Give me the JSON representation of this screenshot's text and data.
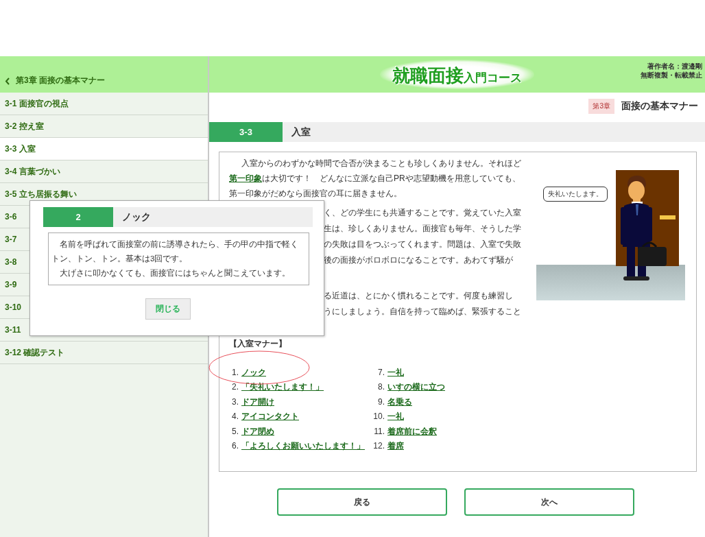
{
  "sidebar": {
    "chapter_title": "第3章 面接の基本マナー",
    "items": [
      {
        "label": "3-1 面接官の視点",
        "selected": false
      },
      {
        "label": "3-2 控え室",
        "selected": false
      },
      {
        "label": "3-3 入室",
        "selected": true
      },
      {
        "label": "3-4 言葉づかい",
        "selected": false
      },
      {
        "label": "3-5 立ち居振る舞い",
        "selected": false
      },
      {
        "label": "3-6",
        "selected": false
      },
      {
        "label": "3-7",
        "selected": false
      },
      {
        "label": "3-8",
        "selected": false
      },
      {
        "label": "3-9",
        "selected": false
      },
      {
        "label": "3-10",
        "selected": false
      },
      {
        "label": "3-11",
        "selected": false
      },
      {
        "label": "3-12 確認テスト",
        "selected": false
      }
    ]
  },
  "header": {
    "logo_main": "就職面接",
    "logo_sub": "入門コース",
    "credits": [
      "著作者名：渡邉剛",
      "無断複製・転載禁止"
    ]
  },
  "chapter": {
    "badge": "第3章",
    "title": "面接の基本マナー"
  },
  "section": {
    "number": "3-3",
    "title": "入室"
  },
  "content": {
    "intro": {
      "before": "入室からのわずかな時間で合否が決まることも珍しくありません。それほど",
      "link": "第一印象",
      "after": "は大切です！　どんなに立派な自己PRや志望動機を用意していても、第一印象がだめなら面接官の耳に届きません。"
    },
    "partial_paragraphs": [
      [
        "く、どの学生にも共通することです。覚えていた入室",
        "生は、珍しくありません。面接官も毎年、そうした学",
        "の失敗は目をつぶってくれます。問題は、入室で失敗",
        "後の面接がボロボロになることです。あわてず騒が"
      ],
      [
        "る近道は、とにかく慣れることです。何度も練習し",
        "うにしましょう。自信を持って臨めば、緊張すること"
      ]
    ],
    "speech": "失礼いたします。",
    "list_title": "【入室マナー】",
    "steps": [
      {
        "number": "1.",
        "label": "ノック"
      },
      {
        "number": "2.",
        "label": "「失礼いたします！」"
      },
      {
        "number": "3.",
        "label": "ドア開け"
      },
      {
        "number": "4.",
        "label": "アイコンタクト"
      },
      {
        "number": "5.",
        "label": "ドア閉め"
      },
      {
        "number": "6.",
        "label": "「よろしくお願いいたします！」"
      },
      {
        "number": "7.",
        "label": "一礼"
      },
      {
        "number": "8.",
        "label": "いすの横に立つ"
      },
      {
        "number": "9.",
        "label": "名乗る"
      },
      {
        "number": "10.",
        "label": "一礼"
      },
      {
        "number": "11.",
        "label": "着席前に会釈"
      },
      {
        "number": "12.",
        "label": "着席"
      }
    ]
  },
  "nav_buttons": [
    "戻る",
    "次へ"
  ],
  "popup": {
    "number": "2",
    "title": "ノック",
    "paragraphs": [
      "名前を呼ばれて面接室の前に誘導されたら、手の甲の中指で軽くトン、トン、トン。基本は3回です。",
      "大げさに叩かなくても、面接官にはちゃんと聞こえています。"
    ],
    "close_button": "閉じる"
  }
}
